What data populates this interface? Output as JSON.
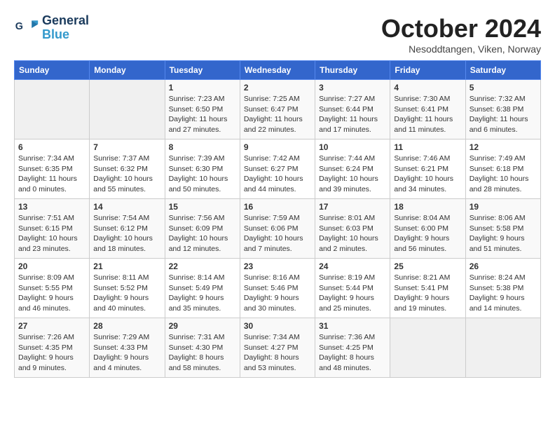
{
  "logo": {
    "line1": "General",
    "line2": "Blue"
  },
  "title": "October 2024",
  "subtitle": "Nesoddtangen, Viken, Norway",
  "headers": [
    "Sunday",
    "Monday",
    "Tuesday",
    "Wednesday",
    "Thursday",
    "Friday",
    "Saturday"
  ],
  "weeks": [
    [
      {
        "day": "",
        "info": ""
      },
      {
        "day": "",
        "info": ""
      },
      {
        "day": "1",
        "info": "Sunrise: 7:23 AM\nSunset: 6:50 PM\nDaylight: 11 hours\nand 27 minutes."
      },
      {
        "day": "2",
        "info": "Sunrise: 7:25 AM\nSunset: 6:47 PM\nDaylight: 11 hours\nand 22 minutes."
      },
      {
        "day": "3",
        "info": "Sunrise: 7:27 AM\nSunset: 6:44 PM\nDaylight: 11 hours\nand 17 minutes."
      },
      {
        "day": "4",
        "info": "Sunrise: 7:30 AM\nSunset: 6:41 PM\nDaylight: 11 hours\nand 11 minutes."
      },
      {
        "day": "5",
        "info": "Sunrise: 7:32 AM\nSunset: 6:38 PM\nDaylight: 11 hours\nand 6 minutes."
      }
    ],
    [
      {
        "day": "6",
        "info": "Sunrise: 7:34 AM\nSunset: 6:35 PM\nDaylight: 11 hours\nand 0 minutes."
      },
      {
        "day": "7",
        "info": "Sunrise: 7:37 AM\nSunset: 6:32 PM\nDaylight: 10 hours\nand 55 minutes."
      },
      {
        "day": "8",
        "info": "Sunrise: 7:39 AM\nSunset: 6:30 PM\nDaylight: 10 hours\nand 50 minutes."
      },
      {
        "day": "9",
        "info": "Sunrise: 7:42 AM\nSunset: 6:27 PM\nDaylight: 10 hours\nand 44 minutes."
      },
      {
        "day": "10",
        "info": "Sunrise: 7:44 AM\nSunset: 6:24 PM\nDaylight: 10 hours\nand 39 minutes."
      },
      {
        "day": "11",
        "info": "Sunrise: 7:46 AM\nSunset: 6:21 PM\nDaylight: 10 hours\nand 34 minutes."
      },
      {
        "day": "12",
        "info": "Sunrise: 7:49 AM\nSunset: 6:18 PM\nDaylight: 10 hours\nand 28 minutes."
      }
    ],
    [
      {
        "day": "13",
        "info": "Sunrise: 7:51 AM\nSunset: 6:15 PM\nDaylight: 10 hours\nand 23 minutes."
      },
      {
        "day": "14",
        "info": "Sunrise: 7:54 AM\nSunset: 6:12 PM\nDaylight: 10 hours\nand 18 minutes."
      },
      {
        "day": "15",
        "info": "Sunrise: 7:56 AM\nSunset: 6:09 PM\nDaylight: 10 hours\nand 12 minutes."
      },
      {
        "day": "16",
        "info": "Sunrise: 7:59 AM\nSunset: 6:06 PM\nDaylight: 10 hours\nand 7 minutes."
      },
      {
        "day": "17",
        "info": "Sunrise: 8:01 AM\nSunset: 6:03 PM\nDaylight: 10 hours\nand 2 minutes."
      },
      {
        "day": "18",
        "info": "Sunrise: 8:04 AM\nSunset: 6:00 PM\nDaylight: 9 hours\nand 56 minutes."
      },
      {
        "day": "19",
        "info": "Sunrise: 8:06 AM\nSunset: 5:58 PM\nDaylight: 9 hours\nand 51 minutes."
      }
    ],
    [
      {
        "day": "20",
        "info": "Sunrise: 8:09 AM\nSunset: 5:55 PM\nDaylight: 9 hours\nand 46 minutes."
      },
      {
        "day": "21",
        "info": "Sunrise: 8:11 AM\nSunset: 5:52 PM\nDaylight: 9 hours\nand 40 minutes."
      },
      {
        "day": "22",
        "info": "Sunrise: 8:14 AM\nSunset: 5:49 PM\nDaylight: 9 hours\nand 35 minutes."
      },
      {
        "day": "23",
        "info": "Sunrise: 8:16 AM\nSunset: 5:46 PM\nDaylight: 9 hours\nand 30 minutes."
      },
      {
        "day": "24",
        "info": "Sunrise: 8:19 AM\nSunset: 5:44 PM\nDaylight: 9 hours\nand 25 minutes."
      },
      {
        "day": "25",
        "info": "Sunrise: 8:21 AM\nSunset: 5:41 PM\nDaylight: 9 hours\nand 19 minutes."
      },
      {
        "day": "26",
        "info": "Sunrise: 8:24 AM\nSunset: 5:38 PM\nDaylight: 9 hours\nand 14 minutes."
      }
    ],
    [
      {
        "day": "27",
        "info": "Sunrise: 7:26 AM\nSunset: 4:35 PM\nDaylight: 9 hours\nand 9 minutes."
      },
      {
        "day": "28",
        "info": "Sunrise: 7:29 AM\nSunset: 4:33 PM\nDaylight: 9 hours\nand 4 minutes."
      },
      {
        "day": "29",
        "info": "Sunrise: 7:31 AM\nSunset: 4:30 PM\nDaylight: 8 hours\nand 58 minutes."
      },
      {
        "day": "30",
        "info": "Sunrise: 7:34 AM\nSunset: 4:27 PM\nDaylight: 8 hours\nand 53 minutes."
      },
      {
        "day": "31",
        "info": "Sunrise: 7:36 AM\nSunset: 4:25 PM\nDaylight: 8 hours\nand 48 minutes."
      },
      {
        "day": "",
        "info": ""
      },
      {
        "day": "",
        "info": ""
      }
    ]
  ]
}
